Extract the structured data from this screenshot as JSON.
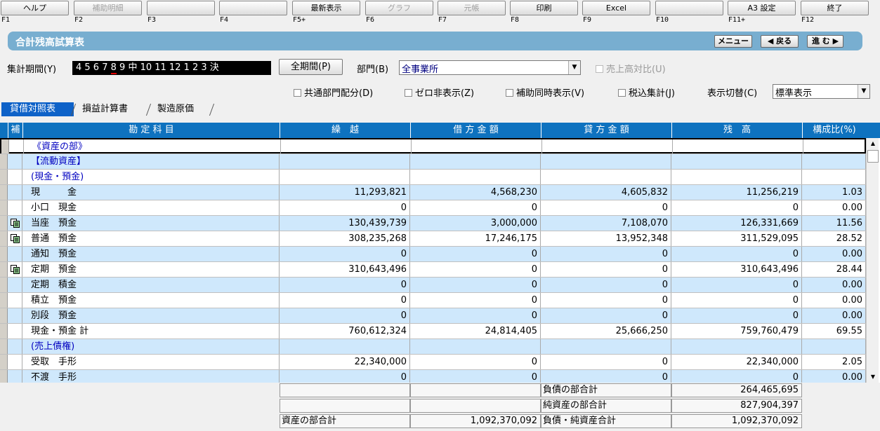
{
  "fkeys": [
    {
      "label": "ヘルプ",
      "key": "F1",
      "enabled": true
    },
    {
      "label": "補助明細",
      "key": "F2",
      "enabled": false
    },
    {
      "label": "",
      "key": "F3",
      "enabled": true
    },
    {
      "label": "",
      "key": "F4",
      "enabled": true
    },
    {
      "label": "最新表示",
      "key": "F5+",
      "enabled": true
    },
    {
      "label": "グラフ",
      "key": "F6",
      "enabled": false
    },
    {
      "label": "元帳",
      "key": "F7",
      "enabled": false
    },
    {
      "label": "印刷",
      "key": "F8",
      "enabled": true
    },
    {
      "label": "Excel",
      "key": "F9",
      "enabled": true
    },
    {
      "label": "",
      "key": "F10",
      "enabled": true
    },
    {
      "label": "A3 設定",
      "key": "F11+",
      "enabled": true
    },
    {
      "label": "終了",
      "key": "F12",
      "enabled": true
    }
  ],
  "title": "合計残高試算表",
  "nav": {
    "menu": "メニュー",
    "back": "◀ 戻る",
    "next": "進 む ▶"
  },
  "filters": {
    "period_label": "集計期間(Y)",
    "period_pre": "4 5 6 7 ",
    "period_mark": "8",
    "period_post": " 9 中 10 11 12 1 2 3 決",
    "full_period": "全期間(P)",
    "dept_label": "部門(B)",
    "dept_value": "全事業所",
    "sales_ratio": "売上高対比(U)",
    "common_dept": "共通部門配分(D)",
    "zero_hide": "ゼロ非表示(Z)",
    "sub_display": "補助同時表示(V)",
    "tax_incl": "税込集計(J)",
    "view_label": "表示切替(C)",
    "view_value": "標準表示"
  },
  "tabs": [
    "貸借対照表",
    "損益計算書",
    "製造原価"
  ],
  "columns": {
    "ho": "補",
    "account": "勘 定 科 目",
    "carry": "繰　越",
    "debit": "借 方 金 額",
    "credit": "貸 方 金 額",
    "balance": "残　高",
    "ratio": "構成比(%)"
  },
  "rows": [
    {
      "name": "《資産の部》",
      "heading": true
    },
    {
      "name": "【流動資産】",
      "heading": true
    },
    {
      "name": "(現金・預金)",
      "heading": true
    },
    {
      "name": "現　　　金",
      "carry": "11,293,821",
      "debit": "4,568,230",
      "credit": "4,605,832",
      "balance": "11,256,219",
      "ratio": "1.03"
    },
    {
      "name": "小口　現金",
      "carry": "0",
      "debit": "0",
      "credit": "0",
      "balance": "0",
      "ratio": "0.00"
    },
    {
      "name": "当座　預金",
      "doc": true,
      "carry": "130,439,739",
      "debit": "3,000,000",
      "credit": "7,108,070",
      "balance": "126,331,669",
      "ratio": "11.56"
    },
    {
      "name": "普通　預金",
      "doc": true,
      "carry": "308,235,268",
      "debit": "17,246,175",
      "credit": "13,952,348",
      "balance": "311,529,095",
      "ratio": "28.52"
    },
    {
      "name": "通知　預金",
      "carry": "0",
      "debit": "0",
      "credit": "0",
      "balance": "0",
      "ratio": "0.00"
    },
    {
      "name": "定期　預金",
      "doc": true,
      "carry": "310,643,496",
      "debit": "0",
      "credit": "0",
      "balance": "310,643,496",
      "ratio": "28.44"
    },
    {
      "name": "定期　積金",
      "carry": "0",
      "debit": "0",
      "credit": "0",
      "balance": "0",
      "ratio": "0.00"
    },
    {
      "name": "積立　預金",
      "carry": "0",
      "debit": "0",
      "credit": "0",
      "balance": "0",
      "ratio": "0.00"
    },
    {
      "name": "別段　預金",
      "carry": "0",
      "debit": "0",
      "credit": "0",
      "balance": "0",
      "ratio": "0.00"
    },
    {
      "name": "現金・預金 計",
      "carry": "760,612,324",
      "debit": "24,814,405",
      "credit": "25,666,250",
      "balance": "759,760,479",
      "ratio": "69.55"
    },
    {
      "name": "(売上債権)",
      "heading": true
    },
    {
      "name": "受取　手形",
      "carry": "22,340,000",
      "debit": "0",
      "credit": "0",
      "balance": "22,340,000",
      "ratio": "2.05"
    },
    {
      "name": "不渡　手形",
      "carry": "0",
      "debit": "0",
      "credit": "0",
      "balance": "0",
      "ratio": "0.00"
    }
  ],
  "totals": {
    "liab_label": "負債の部合計",
    "liab_value": "264,465,695",
    "net_label": "純資産の部合計",
    "net_value": "827,904,397",
    "asset_label": "資産の部合計",
    "asset_value": "1,092,370,092",
    "ln_label": "負債・純資産合計",
    "ln_value": "1,092,370,092"
  }
}
